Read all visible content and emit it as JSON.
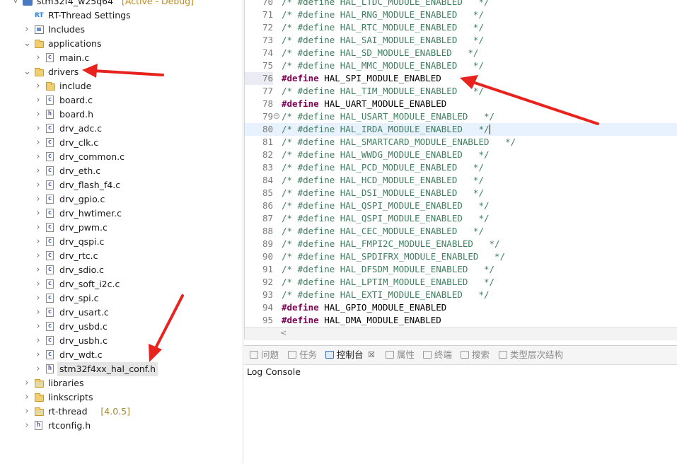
{
  "explorer": {
    "project": {
      "name": "stm32f4_w25q64",
      "status": "[Active - Debug]"
    },
    "items": [
      {
        "id": "rt-settings",
        "label": "RT-Thread Settings",
        "type": "rt",
        "indent": 1,
        "twisty": ""
      },
      {
        "id": "includes",
        "label": "Includes",
        "type": "includes",
        "indent": 1,
        "twisty": ">"
      },
      {
        "id": "applications",
        "label": "applications",
        "type": "folder",
        "indent": 1,
        "twisty": "v"
      },
      {
        "id": "main-c",
        "label": "main.c",
        "type": "c",
        "indent": 2,
        "twisty": ">"
      },
      {
        "id": "drivers",
        "label": "drivers",
        "type": "folder",
        "indent": 1,
        "twisty": "v"
      },
      {
        "id": "include",
        "label": "include",
        "type": "folder",
        "indent": 2,
        "twisty": ">"
      },
      {
        "id": "board-c",
        "label": "board.c",
        "type": "c",
        "indent": 2,
        "twisty": ">"
      },
      {
        "id": "board-h",
        "label": "board.h",
        "type": "h",
        "indent": 2,
        "twisty": ">"
      },
      {
        "id": "drv-adc",
        "label": "drv_adc.c",
        "type": "c",
        "indent": 2,
        "twisty": ">"
      },
      {
        "id": "drv-clk",
        "label": "drv_clk.c",
        "type": "c",
        "indent": 2,
        "twisty": ">"
      },
      {
        "id": "drv-common",
        "label": "drv_common.c",
        "type": "c",
        "indent": 2,
        "twisty": ">"
      },
      {
        "id": "drv-eth",
        "label": "drv_eth.c",
        "type": "c",
        "indent": 2,
        "twisty": ">"
      },
      {
        "id": "drv-flash",
        "label": "drv_flash_f4.c",
        "type": "c",
        "indent": 2,
        "twisty": ">"
      },
      {
        "id": "drv-gpio",
        "label": "drv_gpio.c",
        "type": "c",
        "indent": 2,
        "twisty": ">"
      },
      {
        "id": "drv-hwtimer",
        "label": "drv_hwtimer.c",
        "type": "c",
        "indent": 2,
        "twisty": ">"
      },
      {
        "id": "drv-pwm",
        "label": "drv_pwm.c",
        "type": "c",
        "indent": 2,
        "twisty": ">"
      },
      {
        "id": "drv-qspi",
        "label": "drv_qspi.c",
        "type": "c",
        "indent": 2,
        "twisty": ">"
      },
      {
        "id": "drv-rtc",
        "label": "drv_rtc.c",
        "type": "c",
        "indent": 2,
        "twisty": ">"
      },
      {
        "id": "drv-sdio",
        "label": "drv_sdio.c",
        "type": "c",
        "indent": 2,
        "twisty": ">"
      },
      {
        "id": "drv-soft-i2c",
        "label": "drv_soft_i2c.c",
        "type": "c",
        "indent": 2,
        "twisty": ">"
      },
      {
        "id": "drv-spi",
        "label": "drv_spi.c",
        "type": "c",
        "indent": 2,
        "twisty": ">"
      },
      {
        "id": "drv-usart",
        "label": "drv_usart.c",
        "type": "c",
        "indent": 2,
        "twisty": ">"
      },
      {
        "id": "drv-usbd",
        "label": "drv_usbd.c",
        "type": "c",
        "indent": 2,
        "twisty": ">"
      },
      {
        "id": "drv-usbh",
        "label": "drv_usbh.c",
        "type": "c",
        "indent": 2,
        "twisty": ">"
      },
      {
        "id": "drv-wdt",
        "label": "drv_wdt.c",
        "type": "c",
        "indent": 2,
        "twisty": ">"
      },
      {
        "id": "hal-conf",
        "label": "stm32f4xx_hal_conf.h",
        "type": "h",
        "indent": 2,
        "twisty": ">",
        "selected": true
      },
      {
        "id": "libraries",
        "label": "libraries",
        "type": "folder-lib",
        "indent": 1,
        "twisty": ">"
      },
      {
        "id": "linkscripts",
        "label": "linkscripts",
        "type": "folder",
        "indent": 1,
        "twisty": ">"
      },
      {
        "id": "rt-thread",
        "label": "rt-thread",
        "type": "folder-lib",
        "indent": 1,
        "twisty": ">",
        "version": "[4.0.5]"
      },
      {
        "id": "rtconfig-h",
        "label": "rtconfig.h",
        "type": "h",
        "indent": 1,
        "twisty": ">"
      }
    ]
  },
  "editor": {
    "lines": [
      {
        "n": "70",
        "kind": "cmt",
        "text": "/* #define HAL_LTDC_MODULE_ENABLED   */"
      },
      {
        "n": "71",
        "kind": "cmt",
        "text": "/* #define HAL_RNG_MODULE_ENABLED   */"
      },
      {
        "n": "72",
        "kind": "cmt",
        "text": "/* #define HAL_RTC_MODULE_ENABLED   */"
      },
      {
        "n": "73",
        "kind": "cmt",
        "text": "/* #define HAL_SAI_MODULE_ENABLED   */"
      },
      {
        "n": "74",
        "kind": "cmt",
        "text": "/* #define HAL_SD_MODULE_ENABLED   */"
      },
      {
        "n": "75",
        "kind": "cmt",
        "text": "/* #define HAL_MMC_MODULE_ENABLED   */"
      },
      {
        "n": "76",
        "kind": "def",
        "kw": "#define",
        "text": " HAL_SPI_MODULE_ENABLED",
        "lnhl": true
      },
      {
        "n": "77",
        "kind": "cmt",
        "text": "/* #define HAL_TIM_MODULE_ENABLED   */"
      },
      {
        "n": "78",
        "kind": "def",
        "kw": "#define",
        "text": " HAL_UART_MODULE_ENABLED"
      },
      {
        "n": "79",
        "kind": "cmt",
        "text": "/* #define HAL_USART_MODULE_ENABLED   */",
        "fold": true
      },
      {
        "n": "80",
        "kind": "cmt",
        "text": "/* #define HAL_IRDA_MODULE_ENABLED   */",
        "current": true
      },
      {
        "n": "81",
        "kind": "cmt",
        "text": "/* #define HAL_SMARTCARD_MODULE_ENABLED   */"
      },
      {
        "n": "82",
        "kind": "cmt",
        "text": "/* #define HAL_WWDG_MODULE_ENABLED   */"
      },
      {
        "n": "83",
        "kind": "cmt",
        "text": "/* #define HAL_PCD_MODULE_ENABLED   */"
      },
      {
        "n": "84",
        "kind": "cmt",
        "text": "/* #define HAL_HCD_MODULE_ENABLED   */"
      },
      {
        "n": "85",
        "kind": "cmt",
        "text": "/* #define HAL_DSI_MODULE_ENABLED   */"
      },
      {
        "n": "86",
        "kind": "cmt",
        "text": "/* #define HAL_QSPI_MODULE_ENABLED   */"
      },
      {
        "n": "87",
        "kind": "cmt",
        "text": "/* #define HAL_QSPI_MODULE_ENABLED   */"
      },
      {
        "n": "88",
        "kind": "cmt",
        "text": "/* #define HAL_CEC_MODULE_ENABLED   */"
      },
      {
        "n": "89",
        "kind": "cmt",
        "text": "/* #define HAL_FMPI2C_MODULE_ENABLED   */"
      },
      {
        "n": "90",
        "kind": "cmt",
        "text": "/* #define HAL_SPDIFRX_MODULE_ENABLED   */"
      },
      {
        "n": "91",
        "kind": "cmt",
        "text": "/* #define HAL_DFSDM_MODULE_ENABLED   */"
      },
      {
        "n": "92",
        "kind": "cmt",
        "text": "/* #define HAL_LPTIM_MODULE_ENABLED   */"
      },
      {
        "n": "93",
        "kind": "cmt",
        "text": "/* #define HAL_EXTI_MODULE_ENABLED   */"
      },
      {
        "n": "94",
        "kind": "def",
        "kw": "#define",
        "text": " HAL_GPIO_MODULE_ENABLED"
      },
      {
        "n": "95",
        "kind": "def",
        "kw": "#define",
        "text": " HAL_DMA_MODULE_ENABLED"
      }
    ],
    "scroll_left_glyph": "<"
  },
  "panel": {
    "tabs": [
      {
        "id": "problems",
        "label": "问题",
        "icon": "problems-icon"
      },
      {
        "id": "tasks",
        "label": "任务",
        "icon": "tasks-icon"
      },
      {
        "id": "console",
        "label": "控制台",
        "icon": "console-icon",
        "active": true,
        "close": "☒"
      },
      {
        "id": "properties",
        "label": "属性",
        "icon": "properties-icon"
      },
      {
        "id": "terminal",
        "label": "终端",
        "icon": "terminal-icon"
      },
      {
        "id": "search",
        "label": "搜索",
        "icon": "search-icon"
      },
      {
        "id": "hierarchy",
        "label": "类型层次结构",
        "icon": "hierarchy-icon"
      }
    ],
    "log_title": "Log Console"
  },
  "colors": {
    "comment": "#3f7f5f",
    "keyword": "#7f0055",
    "arrow": "#e8231d",
    "current_line": "#e8f2fe"
  }
}
